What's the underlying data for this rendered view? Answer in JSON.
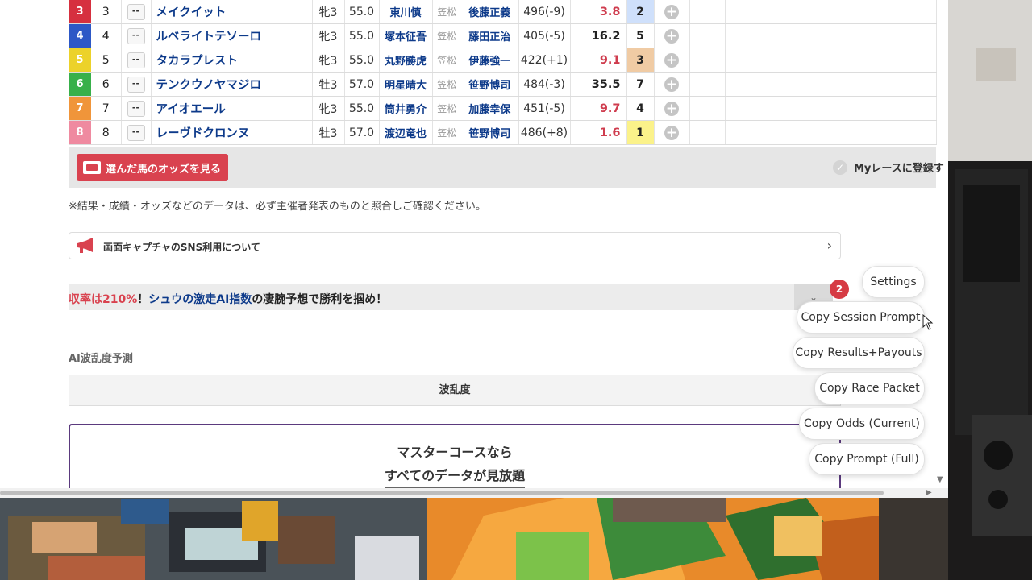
{
  "race_table": {
    "rows": [
      {
        "waku": "3",
        "waku_color": "#d6303f",
        "num": "3",
        "mark": "--",
        "name": "メイクイット",
        "sex_age": "牝3",
        "weight": "55.0",
        "jockey": "東川慎",
        "loc": "笠松",
        "trainer": "後藤正義",
        "body_weight": "496(-9)",
        "odds": "3.8",
        "odds_color": "#cf3c4e",
        "popularity": "2",
        "pop_bg": "#cfe0fb"
      },
      {
        "waku": "4",
        "waku_color": "#2d58c6",
        "num": "4",
        "mark": "--",
        "name": "ルベライトテソーロ",
        "sex_age": "牝3",
        "weight": "55.0",
        "jockey": "塚本征吾",
        "loc": "笠松",
        "trainer": "藤田正治",
        "body_weight": "405(-5)",
        "odds": "16.2",
        "odds_color": "#222222",
        "popularity": "5",
        "pop_bg": "#ffffff"
      },
      {
        "waku": "5",
        "waku_color": "#ecd22a",
        "num": "5",
        "mark": "--",
        "name": "タカラプレスト",
        "sex_age": "牝3",
        "weight": "55.0",
        "jockey": "丸野勝虎",
        "loc": "笠松",
        "trainer": "伊藤強一",
        "body_weight": "422(+1)",
        "odds": "9.1",
        "odds_color": "#cf3c4e",
        "popularity": "3",
        "pop_bg": "#f0cba4"
      },
      {
        "waku": "6",
        "waku_color": "#38b04a",
        "num": "6",
        "mark": "--",
        "name": "テンクウノヤマジロ",
        "sex_age": "牡3",
        "weight": "57.0",
        "jockey": "明星晴大",
        "loc": "笠松",
        "trainer": "笹野博司",
        "body_weight": "484(-3)",
        "odds": "35.5",
        "odds_color": "#222222",
        "popularity": "7",
        "pop_bg": "#ffffff"
      },
      {
        "waku": "7",
        "waku_color": "#f0953a",
        "num": "7",
        "mark": "--",
        "name": "アイオエール",
        "sex_age": "牝3",
        "weight": "55.0",
        "jockey": "筒井勇介",
        "loc": "笠松",
        "trainer": "加藤幸保",
        "body_weight": "451(-5)",
        "odds": "9.7",
        "odds_color": "#cf3c4e",
        "popularity": "4",
        "pop_bg": "#ffffff"
      },
      {
        "waku": "8",
        "waku_color": "#ef8aa0",
        "num": "8",
        "mark": "--",
        "name": "レーヴドクロンヌ",
        "sex_age": "牡3",
        "weight": "57.0",
        "jockey": "渡辺竜也",
        "loc": "笠松",
        "trainer": "笹野博司",
        "body_weight": "486(+8)",
        "odds": "1.6",
        "odds_color": "#cf3c4e",
        "popularity": "1",
        "pop_bg": "#fbf28a"
      }
    ]
  },
  "odds_button": {
    "label": "選んだ馬のオッズを見る",
    "icon": "odds-icon"
  },
  "myrace": {
    "label": "Myレースに登録す"
  },
  "disclaimer": "※結果・成績・オッズなどのデータは、必ず主催者発表のものと照合しご確認ください。",
  "sns_notice": {
    "label": "画面キャプチャのSNS利用について",
    "icon": "megaphone-icon"
  },
  "banner": {
    "part1": "収率は210%",
    "part2": "！",
    "part3": "シュウの激走AI指数",
    "part4": "の凄腕予想で勝利を掴め！"
  },
  "ai_section": {
    "label": "AI波乱度予測",
    "header": "波乱度"
  },
  "master_course": {
    "line1": "マスターコースなら",
    "line2": "すべてのデータが見放題"
  },
  "floating_menu": {
    "badge": "2",
    "settings": "Settings",
    "copy_session_prompt": "Copy Session Prompt",
    "copy_results_payouts": "Copy Results+Payouts",
    "copy_race_packet": "Copy Race Packet",
    "copy_odds_current": "Copy Odds (Current)",
    "copy_prompt_full": "Copy Prompt (Full)"
  }
}
